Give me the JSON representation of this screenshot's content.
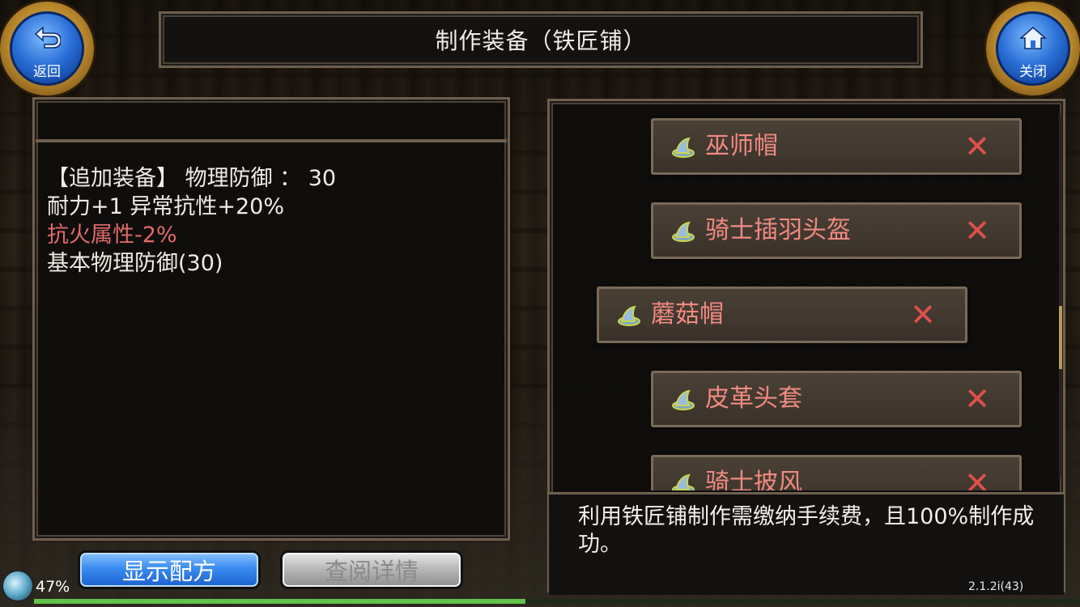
{
  "window": {
    "title": "制作装备（铁匠铺）"
  },
  "nav": {
    "back_label": "返回",
    "close_label": "关闭"
  },
  "item_details": {
    "lines": [
      "【追加装备】 物理防御 ：  30",
      "耐力+1 异常抗性+20%",
      "抗火属性-2%",
      "基本物理防御(30)"
    ],
    "highlight_color": "#e06a6a"
  },
  "recipe_list": {
    "items": [
      {
        "name": "巫师帽",
        "icon": "hat-icon",
        "status": "unavailable"
      },
      {
        "name": "骑士插羽头盔",
        "icon": "hat-icon",
        "status": "unavailable"
      },
      {
        "name": "蘑菇帽",
        "icon": "hat-icon",
        "status": "unavailable",
        "selected": true
      },
      {
        "name": "皮革头套",
        "icon": "hat-icon",
        "status": "unavailable"
      },
      {
        "name": "骑士披风",
        "icon": "hat-icon",
        "status": "unavailable"
      }
    ],
    "scroll_position": 0.55
  },
  "notice": {
    "text": "利用铁匠铺制作需缴纳手续费，且100%制作成功。"
  },
  "buttons": {
    "show_recipe": "显示配方",
    "view_details": "查阅详情"
  },
  "status": {
    "load_percent": "47%",
    "progress": 0.47,
    "version": "2.1.2i(43)"
  }
}
